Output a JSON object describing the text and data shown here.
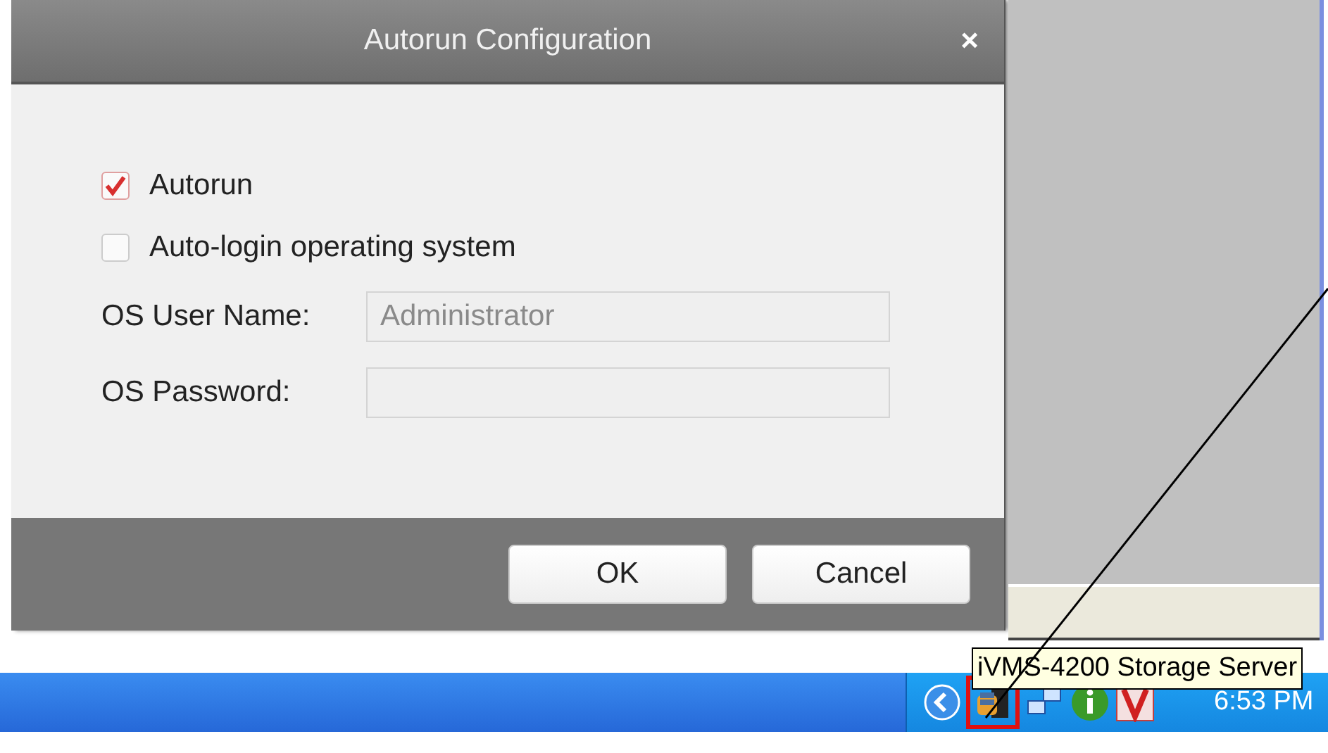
{
  "dialog": {
    "title": "Autorun Configuration",
    "close": "×",
    "options": [
      {
        "label": "Autorun",
        "checked": true
      },
      {
        "label": "Auto-login operating system",
        "checked": false
      }
    ],
    "fields": [
      {
        "label": "OS User Name:",
        "value": "Administrator",
        "disabled": true
      },
      {
        "label": "OS Password:",
        "disabled": true
      }
    ],
    "buttons": [
      "OK",
      "Cancel"
    ]
  },
  "tooltip": "iVMS-4200 Storage Server",
  "taskbar": {
    "clock": "6:53 PM"
  }
}
